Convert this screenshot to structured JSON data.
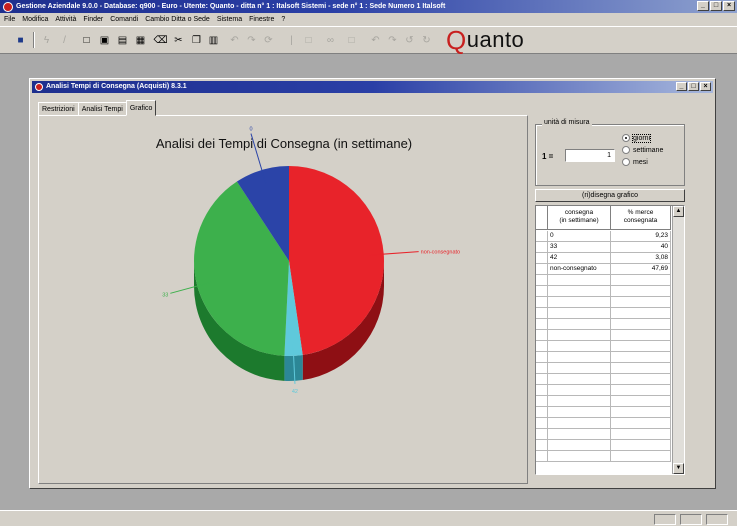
{
  "app": {
    "title": "Gestione Aziendale 9.0.0 - Database: q900 - Euro - Utente: Quanto - ditta n° 1 : Italsoft Sistemi - sede n° 1 : Sede Numero 1 Italsoft",
    "window_buttons": [
      "_",
      "□",
      "×"
    ]
  },
  "menu": [
    "File",
    "Modifica",
    "Attività",
    "Finder",
    "Comandi",
    "Cambio Ditta o Sede",
    "Sistema",
    "Finestre",
    "?"
  ],
  "toolbar": {
    "icons": [
      "app-icon",
      "lightning-icon",
      "pencil-icon",
      "new-document-icon",
      "print-icon",
      "print-preview-icon",
      "save-icon",
      "delete-icon",
      "cut-icon",
      "copy-icon",
      "paste-icon",
      "undo-icon",
      "redo-icon",
      "refresh-icon",
      "first-icon",
      "last-icon",
      "binoculars-icon",
      "filter-icon",
      "back-icon",
      "forward-icon",
      "home-icon",
      "stop-icon"
    ],
    "brand_initial": "Q",
    "brand_rest": "uanto"
  },
  "child_window": {
    "title": "Analisi Tempi di Consegna (Acquisti) 8.3.1",
    "buttons": [
      "_",
      "□",
      "×"
    ],
    "tabs": [
      "Restrizioni",
      "Analisi Tempi",
      "Grafico"
    ],
    "active_tab": "Grafico"
  },
  "chart_data": {
    "type": "pie",
    "title": "Analisi dei Tempi di Consegna (in settimane)",
    "slices": [
      {
        "label": "non-consegnato",
        "value": 47.69,
        "color": "#e8232a",
        "side": "#8e0f14"
      },
      {
        "label": "42",
        "value": 3.08,
        "color": "#5fc9db",
        "side": "#2c8796"
      },
      {
        "label": "33",
        "value": 40,
        "color": "#3db04c",
        "side": "#1c7a2d"
      },
      {
        "label": "0",
        "value": 9.23,
        "color": "#2b44a8",
        "side": "#17266b"
      }
    ]
  },
  "options": {
    "legend": "unità di misura",
    "uom_prefix": "1 =",
    "uom_value": "1",
    "radios": [
      {
        "label": "giorni",
        "checked": true
      },
      {
        "label": "settimane",
        "checked": false
      },
      {
        "label": "mesi",
        "checked": false
      }
    ],
    "redraw_button": "(ri)disegna grafico"
  },
  "table": {
    "headers": [
      "consegna\n(in settimane)",
      "% merce\nconsegnata"
    ],
    "rows": [
      [
        "0",
        "9,23"
      ],
      [
        "33",
        "40"
      ],
      [
        "42",
        "3,08"
      ],
      [
        "non-consegnato",
        "47,69"
      ]
    ],
    "empty_rows": 17
  }
}
